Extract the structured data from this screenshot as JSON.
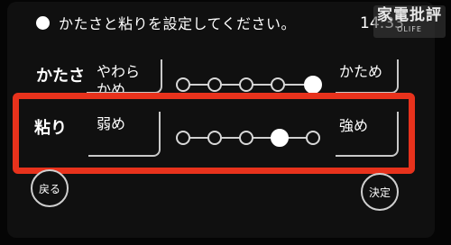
{
  "header": {
    "title": "かたさと粘りを設定してください。",
    "clock": "14:33"
  },
  "watermark": {
    "main": "家電批評",
    "sub": "OLIFE"
  },
  "rows": {
    "firmness": {
      "label": "かたさ",
      "left_option": "やわらかめ",
      "right_option": "かため",
      "level": 5,
      "levels": 5
    },
    "stickiness": {
      "label": "粘り",
      "left_option": "弱め",
      "right_option": "強め",
      "level": 4,
      "levels": 5
    }
  },
  "buttons": {
    "back": "戻る",
    "confirm": "決定"
  },
  "colors": {
    "highlight": "#e8321c"
  }
}
